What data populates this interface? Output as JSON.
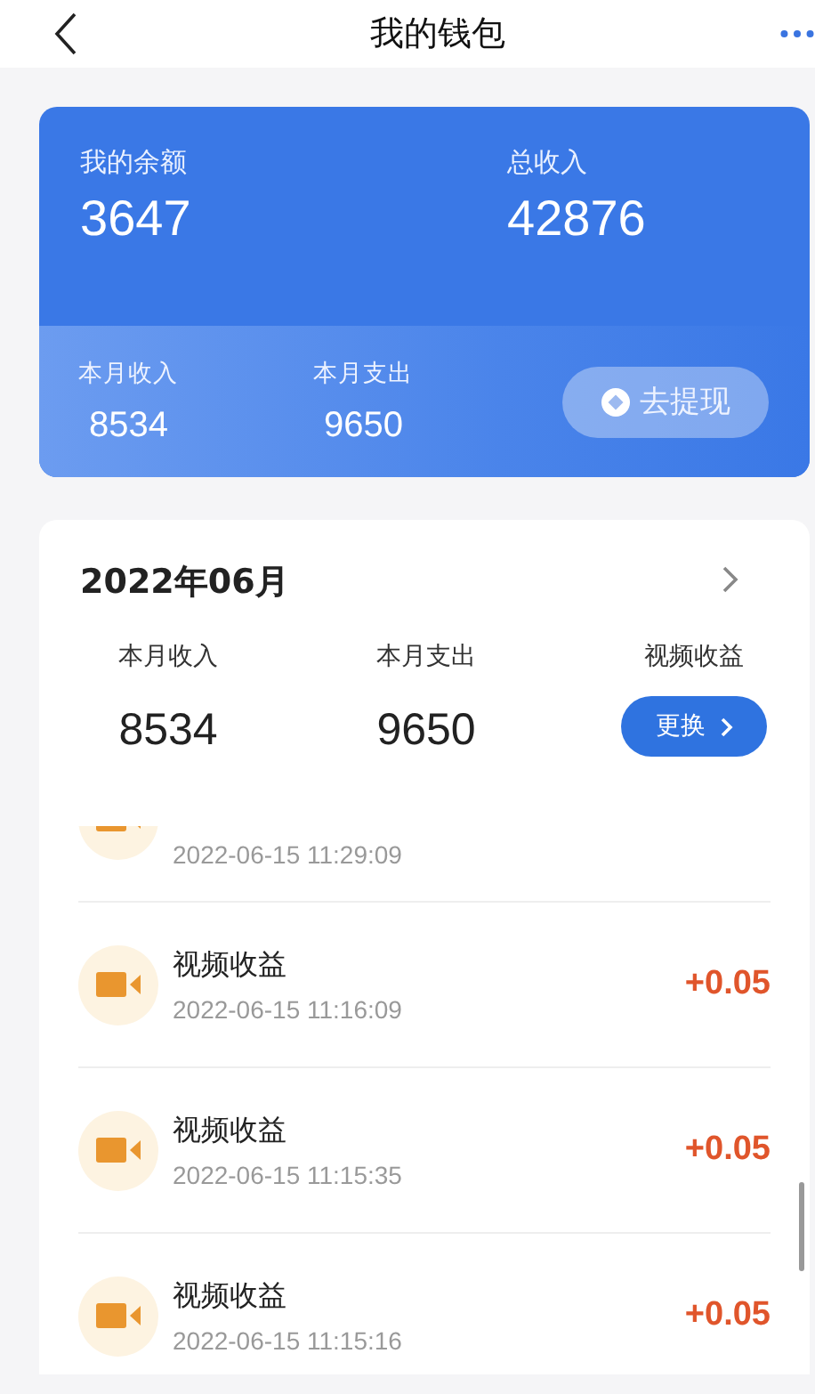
{
  "nav": {
    "title": "我的钱包"
  },
  "balance_card": {
    "balance_label": "我的余额",
    "balance": "3647",
    "total_label": "总收入",
    "total": "42876",
    "month_stats": [
      {
        "label": "本月收入",
        "value": "8534"
      },
      {
        "label": "本月支出",
        "value": "9650"
      }
    ],
    "withdraw_button": "去提现"
  },
  "month_panel": {
    "month": "2022年06月",
    "stats": [
      {
        "label": "本月收入",
        "value": "8534"
      },
      {
        "label": "本月支出",
        "value": "9650"
      }
    ],
    "filter": {
      "label": "视频收益",
      "button": "更换"
    }
  },
  "transactions": [
    {
      "time": "2022-06-15 11:29:09"
    },
    {
      "title": "视频收益",
      "time": "2022-06-15 11:16:09",
      "amount": "+0.05"
    },
    {
      "title": "视频收益",
      "time": "2022-06-15 11:15:35",
      "amount": "+0.05"
    },
    {
      "title": "视频收益",
      "time": "2022-06-15 11:15:16",
      "amount": "+0.05"
    }
  ]
}
